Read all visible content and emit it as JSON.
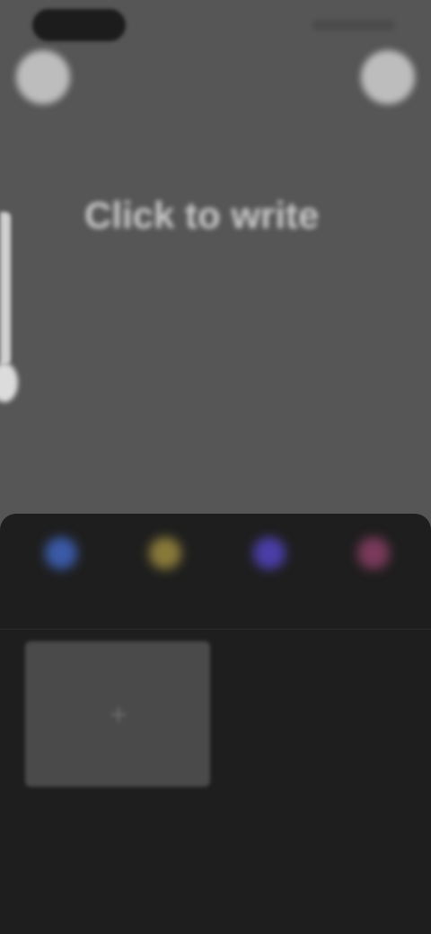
{
  "editor": {
    "headline": "Click to write",
    "left_button_icon": "circle-button-icon",
    "right_button_icon": "circle-button-icon"
  },
  "tools": [
    {
      "label": "",
      "icon": "tool-icon",
      "color": "#3b5aa8"
    },
    {
      "label": "",
      "icon": "tool-icon",
      "color": "#8a7a3a"
    },
    {
      "label": "",
      "icon": "tool-icon",
      "color": "#4b3ea8"
    },
    {
      "label": "",
      "icon": "tool-icon",
      "color": "#7a3a5a"
    }
  ],
  "media": {
    "add_icon": "plus-icon",
    "add_symbol": "+"
  }
}
